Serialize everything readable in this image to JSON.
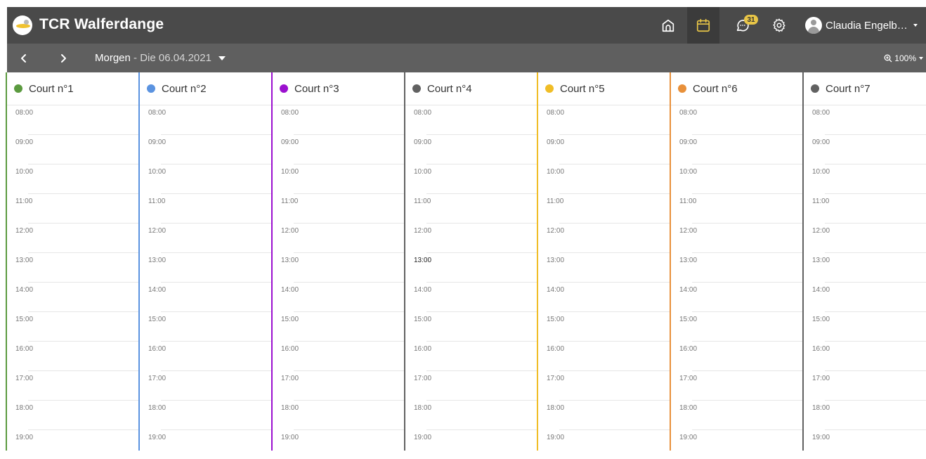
{
  "header": {
    "title": "TCR Walferdange",
    "logo": "club-logo",
    "nav": {
      "home_icon": "home-icon",
      "calendar_icon": "calendar-icon",
      "messages_icon": "chat-icon",
      "settings_icon": "gear-icon",
      "messages_badge": "31",
      "active": "calendar"
    },
    "user": {
      "name": "Claudia Engelb…",
      "avatar": "user-avatar-icon"
    }
  },
  "toolbar": {
    "prev_icon": "chevron-left-icon",
    "next_icon": "chevron-right-icon",
    "day_label": "Morgen",
    "separator": " - ",
    "date_label": "Die 06.04.2021",
    "zoom_icon": "zoom-in-icon",
    "zoom_label": "100%"
  },
  "colors": {
    "topbar": "#4a4a4a",
    "subbar": "#5f5f5f",
    "accent_active": "#e8c547"
  },
  "courts": [
    {
      "name": "Court n°1",
      "color": "#5b9a3f"
    },
    {
      "name": "Court n°2",
      "color": "#5b93e0"
    },
    {
      "name": "Court n°3",
      "color": "#9b10cf"
    },
    {
      "name": "Court n°4",
      "color": "#616161"
    },
    {
      "name": "Court n°5",
      "color": "#f0bd26"
    },
    {
      "name": "Court n°6",
      "color": "#e8903a"
    },
    {
      "name": "Court n°7",
      "color": "#616161"
    }
  ],
  "time_slots": [
    "08:00",
    "09:00",
    "10:00",
    "11:00",
    "12:00",
    "13:00",
    "14:00",
    "15:00",
    "16:00",
    "17:00",
    "18:00",
    "19:00"
  ],
  "highlight": {
    "court_index": 3,
    "slot": "13:00"
  }
}
